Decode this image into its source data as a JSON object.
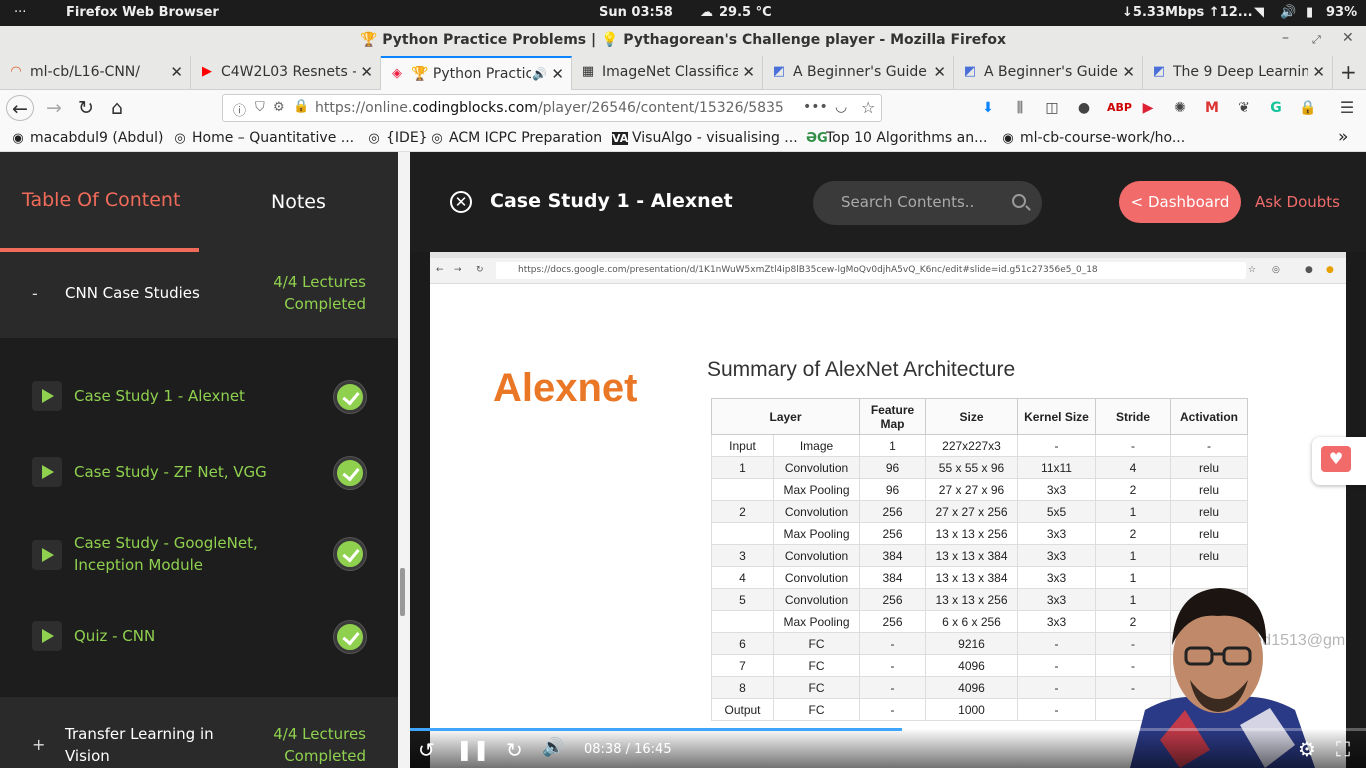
{
  "os_bar": {
    "menu": "···",
    "app": "Firefox Web Browser",
    "clock": "Sun 03:58",
    "weather": "29.5 °C",
    "network": "↓5.33Mbps ↑12...",
    "battery": "93%"
  },
  "window": {
    "title": "🏆 Python Practice Problems | 💡 Pythagorean's Challenge player - Mozilla Firefox"
  },
  "tabs": [
    {
      "label": "ml-cb/L16-CNN/",
      "icon": "github-icon"
    },
    {
      "label": "C4W2L03 Resnets -",
      "icon": "youtube-icon"
    },
    {
      "label": "🏆 Python Practic",
      "icon": "codingblocks-icon"
    },
    {
      "label": "ImageNet Classifica",
      "icon": "paper-icon"
    },
    {
      "label": "A Beginner's Guide",
      "icon": "page-icon"
    },
    {
      "label": "A Beginner's Guide",
      "icon": "page-icon"
    },
    {
      "label": "The 9 Deep Learning",
      "icon": "page-icon"
    }
  ],
  "url": {
    "prefix": "https://online.",
    "domain": "codingblocks.com",
    "path": "/player/26546/content/15326/5835"
  },
  "bookmarks": [
    {
      "label": "macabdul9 (Abdul)"
    },
    {
      "label": "Home – Quantitative ..."
    },
    {
      "label": "{IDE}"
    },
    {
      "label": "ACM ICPC Preparation"
    },
    {
      "label": "VisuAlgo - visualising ..."
    },
    {
      "label": "Top 10 Algorithms an..."
    },
    {
      "label": "ml-cb-course-work/ho..."
    }
  ],
  "sidebar": {
    "tab_toc": "Table Of Content",
    "tab_notes": "Notes",
    "sections": [
      {
        "symbol": "-",
        "name": "CNN Case Studies",
        "status_line1": "4/4 Lectures",
        "status_line2": "Completed"
      },
      {
        "symbol": "+",
        "name_line1": "Transfer Learning in",
        "name_line2": "Vision",
        "status_line1": "4/4 Lectures",
        "status_line2": "Completed"
      }
    ],
    "lectures": [
      {
        "title_line1": "Case Study 1 - Alexnet",
        "title_line2": ""
      },
      {
        "title_line1": "Case Study - ZF Net, VGG",
        "title_line2": ""
      },
      {
        "title_line1": "Case Study - GoogleNet,",
        "title_line2": "Inception Module"
      },
      {
        "title_line1": "Quiz - CNN",
        "title_line2": ""
      }
    ]
  },
  "player": {
    "lecture_title": "Case Study 1 - Alexnet",
    "search_placeholder": "Search Contents..",
    "dashboard_label": "< Dashboard",
    "ask_doubts_label": "Ask Doubts",
    "time_current": "08:38",
    "time_total": "16:45",
    "progress_fraction": 0.515
  },
  "slide": {
    "inner_url": "https://docs.google.com/presentation/d/1K1nWuW5xmZtl4ip8lB35cew-lgMoQv0djhA5vQ_K6nc/edit#slide=id.g51c27356e5_0_18",
    "logo": "Alexnet",
    "title": "Summary of AlexNet Architecture",
    "headers": [
      "Layer",
      "",
      "Feature Map",
      "Size",
      "Kernel Size",
      "Stride",
      "Activation"
    ],
    "rows": [
      [
        "Input",
        "Image",
        "1",
        "227x227x3",
        "-",
        "-",
        "-"
      ],
      [
        "1",
        "Convolution",
        "96",
        "55 x 55 x 96",
        "11x11",
        "4",
        "relu"
      ],
      [
        "",
        "Max Pooling",
        "96",
        "27 x 27 x 96",
        "3x3",
        "2",
        "relu"
      ],
      [
        "2",
        "Convolution",
        "256",
        "27 x 27 x 256",
        "5x5",
        "1",
        "relu"
      ],
      [
        "",
        "Max Pooling",
        "256",
        "13 x 13 x 256",
        "3x3",
        "2",
        "relu"
      ],
      [
        "3",
        "Convolution",
        "384",
        "13 x 13 x 384",
        "3x3",
        "1",
        "relu"
      ],
      [
        "4",
        "Convolution",
        "384",
        "13 x 13 x 384",
        "3x3",
        "1",
        ""
      ],
      [
        "5",
        "Convolution",
        "256",
        "13 x 13 x 256",
        "3x3",
        "1",
        ""
      ],
      [
        "",
        "Max Pooling",
        "256",
        "6 x 6 x 256",
        "3x3",
        "2",
        ""
      ],
      [
        "6",
        "FC",
        "-",
        "9216",
        "-",
        "-",
        ""
      ],
      [
        "7",
        "FC",
        "-",
        "4096",
        "-",
        "-",
        ""
      ],
      [
        "8",
        "FC",
        "-",
        "4096",
        "-",
        "-",
        ""
      ],
      [
        "Output",
        "FC",
        "-",
        "1000",
        "-",
        "",
        ""
      ]
    ],
    "watermark": "abdulwaheed1513@gmail."
  },
  "colors": {
    "accent": "#f16b6b",
    "complete_green": "#8fd14f",
    "logo_orange": "#e97726"
  }
}
